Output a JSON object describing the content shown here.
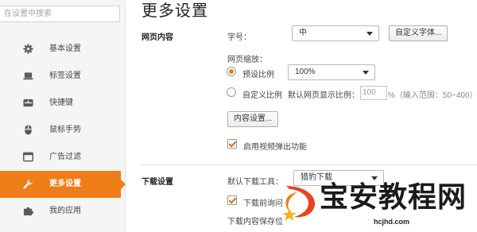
{
  "sidebar": {
    "search_placeholder": "在设置中搜索",
    "items": [
      {
        "label": "基本设置",
        "icon": "gear-icon"
      },
      {
        "label": "标签设置",
        "icon": "laptop-icon"
      },
      {
        "label": "快捷键",
        "icon": "keyboard-icon"
      },
      {
        "label": "鼠标手势",
        "icon": "mouse-icon"
      },
      {
        "label": "广告过滤",
        "icon": "window-icon"
      },
      {
        "label": "更多设置",
        "icon": "wrench-icon",
        "active": true
      },
      {
        "label": "我的应用",
        "icon": "puzzle-icon"
      }
    ]
  },
  "main": {
    "title": "更多设置",
    "web_content": {
      "section_label": "网页内容",
      "font_size_label": "字号：",
      "font_size_value": "中",
      "custom_font_button": "自定义字体...",
      "zoom_label": "网页缩放：",
      "preset_zoom_label": "预设比例",
      "preset_zoom_value": "100%",
      "custom_zoom_label": "自定义比例",
      "default_zoom_label": "默认网页显示比例：",
      "default_zoom_value": "100",
      "zoom_range_hint": "%（输入范围：50~400）",
      "content_settings_button": "内容设置...",
      "video_popup_label": "启用视频弹出功能"
    },
    "downloads": {
      "section_label": "下载设置",
      "default_tool_label": "默认下载工具：",
      "default_tool_value": "猎豹下载",
      "ask_before_label": "下载前询问",
      "save_location_label": "下载内容保存位"
    }
  },
  "watermark": {
    "text": "宝安教程网",
    "url": "hcjhd.com"
  },
  "colors": {
    "accent": "#f07d17",
    "sidebar_bg": "#f5f5f5"
  }
}
